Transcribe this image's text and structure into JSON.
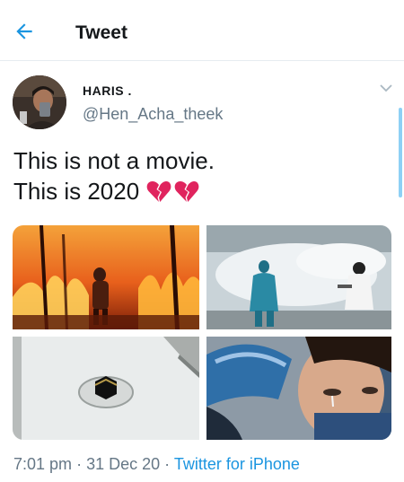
{
  "header": {
    "title": "Tweet",
    "back_icon": "arrow-left-icon"
  },
  "author": {
    "name": "HARIS .",
    "handle": "@Hen_Acha_theek"
  },
  "tweet": {
    "lines": [
      "This is not a movie.",
      "This is 2020"
    ],
    "emojis": [
      "broken-heart-icon",
      "broken-heart-icon"
    ],
    "timestamp": "7:01 pm",
    "separator": "·",
    "date": "31 Dec 20",
    "source": "Twitter for iPhone"
  },
  "colors": {
    "accent": "#1b95e0",
    "text": "#14171a",
    "muted": "#657786",
    "heart": "#e0245e"
  }
}
